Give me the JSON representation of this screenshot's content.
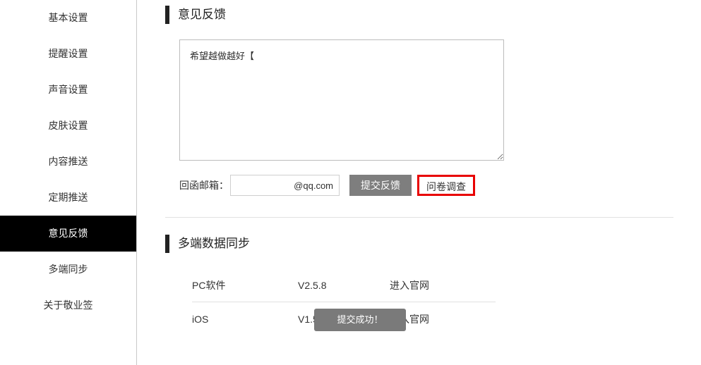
{
  "sidebar": {
    "items": [
      {
        "label": "基本设置"
      },
      {
        "label": "提醒设置"
      },
      {
        "label": "声音设置"
      },
      {
        "label": "皮肤设置"
      },
      {
        "label": "内容推送"
      },
      {
        "label": "定期推送"
      },
      {
        "label": "意见反馈"
      },
      {
        "label": "多端同步"
      },
      {
        "label": "关于敬业签"
      }
    ],
    "active_index": 6
  },
  "feedback": {
    "section_title": "意见反馈",
    "textarea_value": "希望越做越好【",
    "email_label": "回函邮箱：",
    "email_value": "@qq.com",
    "submit_label": "提交反馈",
    "survey_label": "问卷调查"
  },
  "sync": {
    "section_title": "多端数据同步",
    "rows": [
      {
        "name": "PC软件",
        "version": "V2.5.8",
        "link": "进入官网"
      },
      {
        "name": "iOS",
        "version": "V1.5.2",
        "link": "进入官网"
      }
    ]
  },
  "toast": {
    "message": "提交成功！"
  }
}
